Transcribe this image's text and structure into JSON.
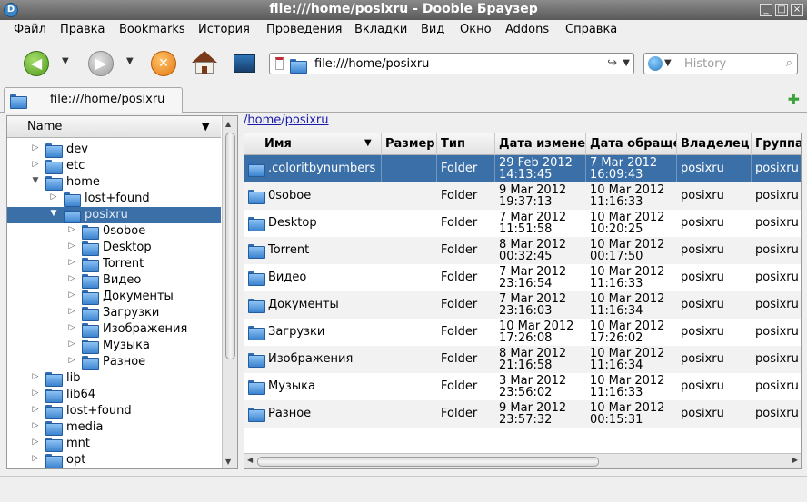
{
  "window": {
    "title": "file:///home/posixru - Dooble Браузер",
    "app_icon": "dooble-icon"
  },
  "menu": [
    "Файл",
    "Правка",
    "Bookmarks",
    "История",
    "Проведения",
    "Вкладки",
    "Вид",
    "Окно",
    "Addons",
    "Справка"
  ],
  "toolbar": {
    "url": "file:///home/posixru",
    "search_placeholder": "History"
  },
  "tab": {
    "label": "file:///home/posixru"
  },
  "tree": {
    "header": "Name",
    "rows": [
      {
        "label": "dev",
        "depth": 0,
        "expander": "collapsed"
      },
      {
        "label": "etc",
        "depth": 0,
        "expander": "collapsed"
      },
      {
        "label": "home",
        "depth": 0,
        "expander": "expanded"
      },
      {
        "label": "lost+found",
        "depth": 1,
        "expander": "collapsed"
      },
      {
        "label": "posixru",
        "depth": 1,
        "expander": "expanded",
        "selected": true
      },
      {
        "label": "0soboe",
        "depth": 2,
        "expander": "collapsed"
      },
      {
        "label": "Desktop",
        "depth": 2,
        "expander": "collapsed"
      },
      {
        "label": "Torrent",
        "depth": 2,
        "expander": "collapsed"
      },
      {
        "label": "Видео",
        "depth": 2,
        "expander": "collapsed"
      },
      {
        "label": "Документы",
        "depth": 2,
        "expander": "collapsed"
      },
      {
        "label": "Загрузки",
        "depth": 2,
        "expander": "collapsed"
      },
      {
        "label": "Изображения",
        "depth": 2,
        "expander": "collapsed"
      },
      {
        "label": "Музыка",
        "depth": 2,
        "expander": "collapsed"
      },
      {
        "label": "Разное",
        "depth": 2,
        "expander": "collapsed"
      },
      {
        "label": "lib",
        "depth": 0,
        "expander": "collapsed"
      },
      {
        "label": "lib64",
        "depth": 0,
        "expander": "collapsed"
      },
      {
        "label": "lost+found",
        "depth": 0,
        "expander": "collapsed"
      },
      {
        "label": "media",
        "depth": 0,
        "expander": "collapsed"
      },
      {
        "label": "mnt",
        "depth": 0,
        "expander": "collapsed"
      },
      {
        "label": "opt",
        "depth": 0,
        "expander": "collapsed"
      }
    ]
  },
  "breadcrumb": {
    "sep": "/",
    "items": [
      "home",
      "posixru"
    ]
  },
  "files": {
    "columns": [
      "Имя",
      "Размер",
      "Тип",
      "Дата измене",
      "Дата обраще",
      "Владелец",
      "Группа"
    ],
    "rows": [
      {
        "name": ".coloritbynumbers",
        "size": "",
        "type": "Folder",
        "modified": [
          "29 Feb 2012",
          "14:13:45"
        ],
        "accessed": [
          "7 Mar 2012",
          "16:09:43"
        ],
        "owner": "posixru",
        "group": "posixru",
        "selected": true
      },
      {
        "name": "0soboe",
        "size": "",
        "type": "Folder",
        "modified": [
          "9 Mar 2012",
          "19:37:13"
        ],
        "accessed": [
          "10 Mar 2012",
          "11:16:33"
        ],
        "owner": "posixru",
        "group": "posixru"
      },
      {
        "name": "Desktop",
        "size": "",
        "type": "Folder",
        "modified": [
          "7 Mar 2012",
          "11:51:58"
        ],
        "accessed": [
          "10 Mar 2012",
          "10:20:25"
        ],
        "owner": "posixru",
        "group": "posixru"
      },
      {
        "name": "Torrent",
        "size": "",
        "type": "Folder",
        "modified": [
          "8 Mar 2012",
          "00:32:45"
        ],
        "accessed": [
          "10 Mar 2012",
          "00:17:50"
        ],
        "owner": "posixru",
        "group": "posixru"
      },
      {
        "name": "Видео",
        "size": "",
        "type": "Folder",
        "modified": [
          "7 Mar 2012",
          "23:16:54"
        ],
        "accessed": [
          "10 Mar 2012",
          "11:16:33"
        ],
        "owner": "posixru",
        "group": "posixru"
      },
      {
        "name": "Документы",
        "size": "",
        "type": "Folder",
        "modified": [
          "7 Mar 2012",
          "23:16:03"
        ],
        "accessed": [
          "10 Mar 2012",
          "11:16:34"
        ],
        "owner": "posixru",
        "group": "posixru"
      },
      {
        "name": "Загрузки",
        "size": "",
        "type": "Folder",
        "modified": [
          "10 Mar 2012",
          "17:26:08"
        ],
        "accessed": [
          "10 Mar 2012",
          "17:26:02"
        ],
        "owner": "posixru",
        "group": "posixru"
      },
      {
        "name": "Изображения",
        "size": "",
        "type": "Folder",
        "modified": [
          "8 Mar 2012",
          "21:16:58"
        ],
        "accessed": [
          "10 Mar 2012",
          "11:16:34"
        ],
        "owner": "posixru",
        "group": "posixru"
      },
      {
        "name": "Музыка",
        "size": "",
        "type": "Folder",
        "modified": [
          "3 Mar 2012",
          "23:56:02"
        ],
        "accessed": [
          "10 Mar 2012",
          "11:16:33"
        ],
        "owner": "posixru",
        "group": "posixru"
      },
      {
        "name": "Разное",
        "size": "",
        "type": "Folder",
        "modified": [
          "9 Mar 2012",
          "23:57:32"
        ],
        "accessed": [
          "10 Mar 2012",
          "00:15:31"
        ],
        "owner": "posixru",
        "group": "posixru"
      }
    ]
  },
  "colors": {
    "selection": "#3b6fa8",
    "link": "#1b1ba8"
  }
}
